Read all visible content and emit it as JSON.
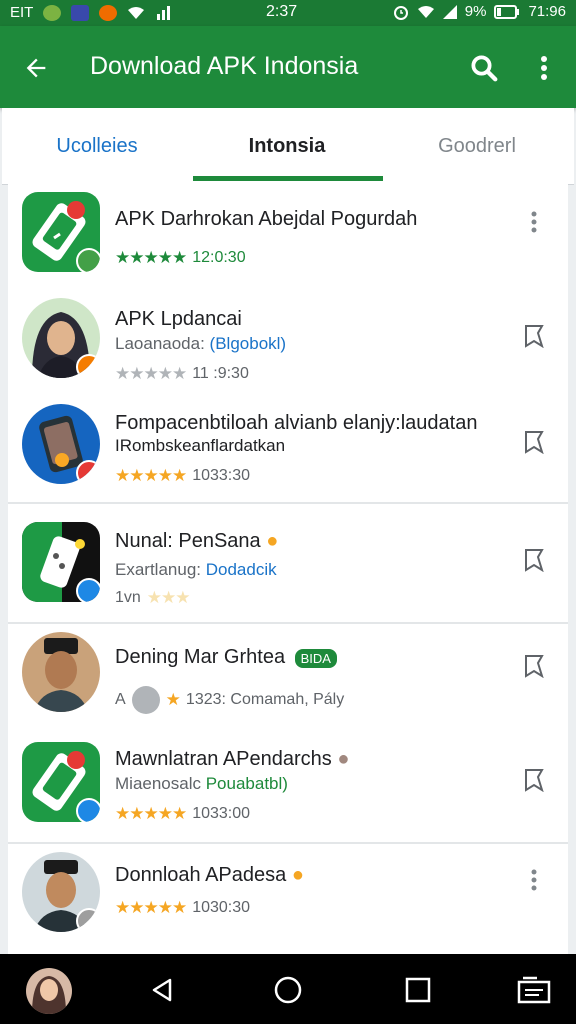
{
  "status_bar": {
    "carrier": "EIT",
    "time": "2:37",
    "battery_text": "9%",
    "clock_right": "71:96"
  },
  "app_bar": {
    "title": "Download APK Indonsia",
    "back_icon": "arrow-left-icon",
    "search_icon": "search-icon",
    "menu_icon": "more-vert-icon"
  },
  "tabs": [
    {
      "label": "Ucolleies",
      "color": "#1a73c8"
    },
    {
      "label": "Intonsia",
      "color": "#202124"
    },
    {
      "label": "Goodrerl",
      "color": "#80868b"
    }
  ],
  "colors": {
    "primary": "#1e8a3b",
    "star": "#f5a623",
    "green_star": "#1e8a3b"
  },
  "apps": [
    {
      "title": "APK Darhrokan Abejdal Pogurdah",
      "subtitle": "",
      "subtitle_highlight": "",
      "rating": "12:0:30",
      "rating_prefix": "",
      "star_style": "green",
      "action": "more-vert-icon"
    },
    {
      "title": "APK Lpdancai",
      "subtitle": "Laoanaoda: ",
      "subtitle_highlight": "(Blgobokl)",
      "rating": "11 :9:30",
      "rating_prefix": "",
      "star_style": "grey",
      "action": "bookmark-icon"
    },
    {
      "title": "Fompacenbtiloah alvianb elanjy:laudatan",
      "subtitle": "IRombskeanflardatkan",
      "subtitle_highlight": "",
      "rating": "1033:30",
      "rating_prefix": "",
      "star_style": "gold",
      "action": "bookmark-icon"
    },
    {
      "title": "Nunal: PenSana",
      "subtitle": "Exartlanug: ",
      "subtitle_highlight": "Dodadcik",
      "rating": "",
      "rating_prefix": "1vn",
      "star_style": "faded",
      "action": "bookmark-icon"
    },
    {
      "title": "Dening Mar Grhtea",
      "title_badge": "BIDA",
      "subtitle": "",
      "subtitle_highlight": "",
      "rating": "1323: Comamah, Pály",
      "rating_prefix": "A",
      "star_style": "single",
      "action": "bookmark-icon"
    },
    {
      "title": "Mawnlatran APendarchs",
      "subtitle": "Miaenosalc ",
      "subtitle_highlight": "Pouabatbl)",
      "rating": "1033:00",
      "rating_prefix": "",
      "star_style": "gold",
      "action": "bookmark-icon"
    },
    {
      "title": "Donnloah APadesa",
      "subtitle": "",
      "subtitle_highlight": "",
      "rating": "1030:30",
      "rating_prefix": "",
      "star_style": "gold",
      "action": "more-vert-icon"
    }
  ],
  "nav_bar": {
    "back": "nav-back-icon",
    "home": "nav-home-icon",
    "recents": "nav-recents-icon",
    "extra": "screenshot-icon"
  }
}
